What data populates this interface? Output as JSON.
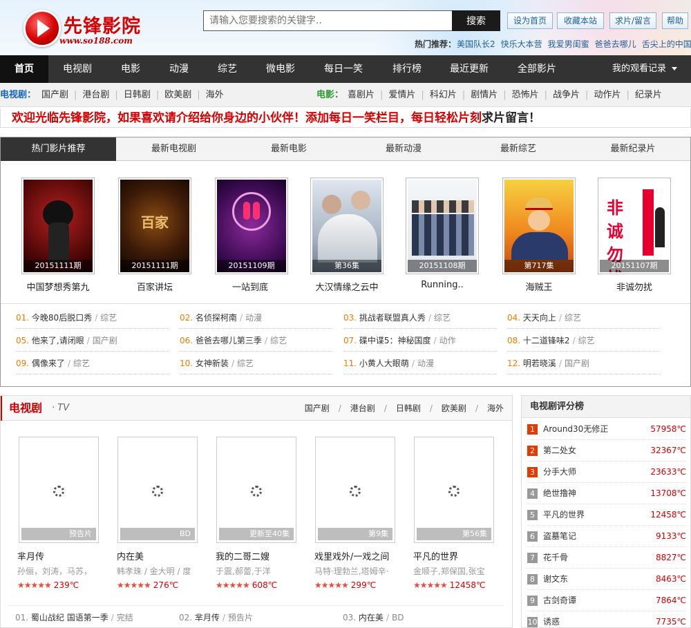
{
  "site": {
    "name": "先锋影院",
    "url": "www.so188.com",
    "colors": {
      "brand_red": "#d40000",
      "nav_dark": "#333333",
      "link_blue": "#1d5f9c",
      "accent_orange": "#f47b00",
      "movie_green": "#2e9a2e"
    }
  },
  "search": {
    "placeholder": "请输入您要搜索的关键字..",
    "button": "搜索"
  },
  "top_links": [
    "设为首页",
    "收藏本站",
    "求片/留言",
    "帮助"
  ],
  "hot_search": {
    "label": "热门推荐：",
    "items": [
      "美国队长2",
      "快乐大本营",
      "我爱男闺蜜",
      "爸爸去哪儿",
      "舌尖上的中国"
    ]
  },
  "main_nav": {
    "items": [
      "首页",
      "电视剧",
      "电影",
      "动漫",
      "综艺",
      "微电影",
      "每日一笑",
      "排行榜",
      "最近更新",
      "全部影片"
    ],
    "history": "我的观看记录"
  },
  "sub_nav": {
    "tv_label": "电视剧：",
    "tv_items": [
      "国产剧",
      "港台剧",
      "日韩剧",
      "欧美剧",
      "海外"
    ],
    "movie_label": "电影：",
    "movie_items": [
      "喜剧片",
      "爱情片",
      "科幻片",
      "剧情片",
      "恐怖片",
      "战争片",
      "动作片",
      "纪录片"
    ]
  },
  "welcome": {
    "red": "欢迎光临先锋影院，如果喜欢请介绍给你身边的小伙伴！添加每日一笑栏目，每日轻松片刻",
    "dark": "求片留言！"
  },
  "hot_tabs": [
    "热门影片推荐",
    "最新电视剧",
    "最新电影",
    "最新动漫",
    "最新综艺",
    "最新纪录片"
  ],
  "hot_posters": [
    {
      "title": "中国梦想秀第九",
      "caption": "20151111期"
    },
    {
      "title": "百家讲坛",
      "caption": "20151111期"
    },
    {
      "title": "一站到底",
      "caption": "20151109期"
    },
    {
      "title": "大汉情缘之云中",
      "caption": "第36集"
    },
    {
      "title": "Running..",
      "caption": "20151108期"
    },
    {
      "title": "海贼王",
      "caption": "第717集"
    },
    {
      "title": "非诚勿扰",
      "caption": "20151107期"
    }
  ],
  "hot_list": [
    {
      "num": "01.",
      "title": "今晚80后脱口秀",
      "cat": "综艺"
    },
    {
      "num": "02.",
      "title": "名侦探柯南",
      "cat": "动漫"
    },
    {
      "num": "03.",
      "title": "挑战者联盟真人秀",
      "cat": "综艺"
    },
    {
      "num": "04.",
      "title": "天天向上",
      "cat": "综艺"
    },
    {
      "num": "05.",
      "title": "他来了,请闭眼",
      "cat": "国产剧"
    },
    {
      "num": "06.",
      "title": "爸爸去哪儿第三季",
      "cat": "综艺"
    },
    {
      "num": "07.",
      "title": "碟中谍5：神秘国度",
      "cat": "动作"
    },
    {
      "num": "08.",
      "title": "十二道锋味2",
      "cat": "综艺"
    },
    {
      "num": "09.",
      "title": "偶像来了",
      "cat": "综艺"
    },
    {
      "num": "10.",
      "title": "女神新装",
      "cat": "综艺"
    },
    {
      "num": "11.",
      "title": "小黄人大眼萌",
      "cat": "动漫"
    },
    {
      "num": "12.",
      "title": "明若晓溪",
      "cat": "国产剧"
    }
  ],
  "tv_section": {
    "title": "电视剧",
    "en": "· TV",
    "links": [
      "国产剧",
      "港台剧",
      "日韩剧",
      "欧美剧",
      "海外"
    ],
    "cards": [
      {
        "title": "芈月传",
        "actors": "孙俪，刘涛，马苏，",
        "badge": "预告片",
        "heat": "239℃",
        "stars": "★★★★★"
      },
      {
        "title": "内在美",
        "actors": "韩孝珠 / 金大明 / 度",
        "badge": "BD",
        "heat": "276℃",
        "stars": "★★★★★"
      },
      {
        "title": "我的二哥二嫂",
        "actors": "于震,郝蕾,于洋",
        "badge": "更新至40集",
        "heat": "608℃",
        "stars": "★★★★★"
      },
      {
        "title": "戏里戏外/一戏之间",
        "actors": "马特·理勃兰,塔姆辛·",
        "badge": "第9集",
        "heat": "299℃",
        "stars": "★★★★★"
      },
      {
        "title": "平凡的世界",
        "actors": "金顺子,郑保国,张宝",
        "badge": "第56集",
        "heat": "12458℃",
        "stars": "★★★★★"
      }
    ],
    "list": [
      {
        "num": "01.",
        "title": "蜀山战纪 国语第一季",
        "cat": "完结"
      },
      {
        "num": "02.",
        "title": "芈月传",
        "cat": "预告片"
      },
      {
        "num": "03.",
        "title": "内在美",
        "cat": "BD"
      }
    ]
  },
  "rank": {
    "title": "电视剧评分榜",
    "items": [
      {
        "n": "1",
        "title": "Around30无修正",
        "heat": "57958℃"
      },
      {
        "n": "2",
        "title": "第二处女",
        "heat": "32367℃"
      },
      {
        "n": "3",
        "title": "分手大师",
        "heat": "23633℃"
      },
      {
        "n": "4",
        "title": "绝世撸神",
        "heat": "13708℃"
      },
      {
        "n": "5",
        "title": "平凡的世界",
        "heat": "12458℃"
      },
      {
        "n": "6",
        "title": "盗墓笔记",
        "heat": "9133℃"
      },
      {
        "n": "7",
        "title": "花千骨",
        "heat": "8827℃"
      },
      {
        "n": "8",
        "title": "谢文东",
        "heat": "8463℃"
      },
      {
        "n": "9",
        "title": "古剑奇谭",
        "heat": "7864℃"
      },
      {
        "n": "10",
        "title": "诱惑",
        "heat": "7735℃"
      }
    ]
  }
}
